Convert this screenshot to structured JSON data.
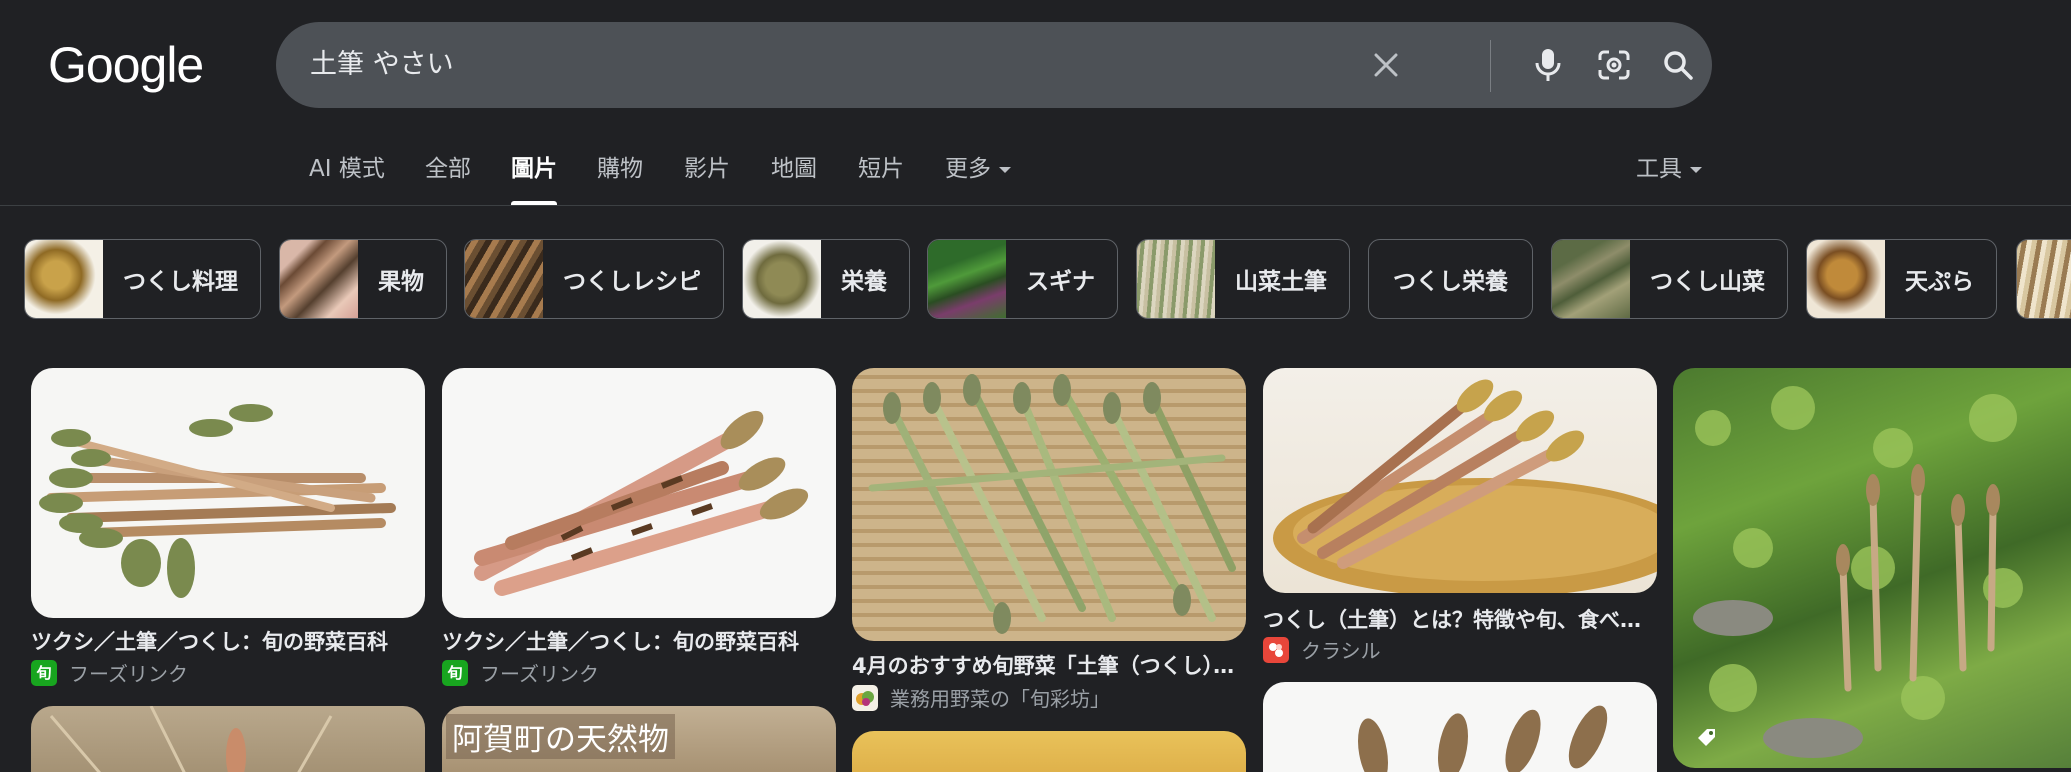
{
  "header": {
    "logo": "Google",
    "search": {
      "query": "土筆 やさい",
      "icons": [
        "clear-icon",
        "mic-icon",
        "lens-icon",
        "search-icon"
      ]
    }
  },
  "tabs": [
    {
      "label": "AI 模式",
      "active": false
    },
    {
      "label": "全部",
      "active": false
    },
    {
      "label": "圖片",
      "active": true
    },
    {
      "label": "購物",
      "active": false
    },
    {
      "label": "影片",
      "active": false
    },
    {
      "label": "地圖",
      "active": false
    },
    {
      "label": "短片",
      "active": false
    },
    {
      "label": "更多",
      "active": false
    }
  ],
  "tools_label": "工具",
  "chips": [
    {
      "label": "つくし料理"
    },
    {
      "label": "果物"
    },
    {
      "label": "つくしレシピ"
    },
    {
      "label": "栄養"
    },
    {
      "label": "スギナ"
    },
    {
      "label": "山菜土筆"
    },
    {
      "label": "つくし栄養"
    },
    {
      "label": "つくし山菜"
    },
    {
      "label": "天ぷら"
    }
  ],
  "results": [
    {
      "title": "ツクシ／土筆／つくし：旬の野菜百科",
      "source": "フーズリンク",
      "favicon": "旬"
    },
    {
      "title": "ツクシ／土筆／つくし：旬の野菜百科",
      "source": "フーズリンク",
      "favicon": "旬"
    },
    {
      "title": "4月のおすすめ旬野菜「土筆（つくし）」…",
      "source": "業務用野菜の「旬彩坊」",
      "favicon": ""
    },
    {
      "title": "つくし（土筆）とは？特徴や旬、食べ方…",
      "source": "クラシル",
      "favicon": ""
    },
    {
      "overlay_text": "阿賀町の天然物"
    }
  ],
  "colors": {
    "background": "#202124",
    "search_box": "#4d5156",
    "chip_border": "#5f6368",
    "favicon_green": "#18a51f",
    "favicon_red": "#e8463a"
  }
}
